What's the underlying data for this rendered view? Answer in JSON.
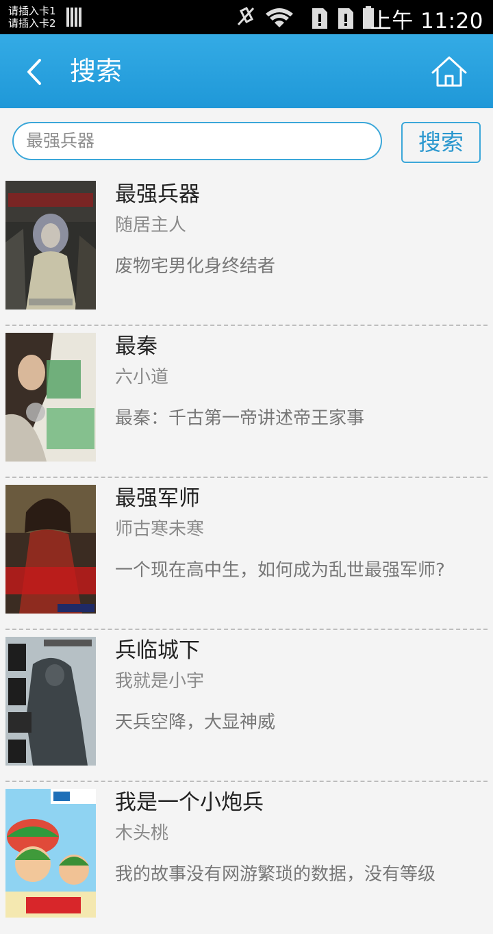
{
  "statusbar": {
    "sim1": "请插入卡1",
    "sim2": "请插入卡2",
    "time": "上午 11:20"
  },
  "header": {
    "title": "搜索",
    "back_icon": "chevron-left-icon",
    "home_icon": "home-icon"
  },
  "search": {
    "value": "最强兵器",
    "button_label": "搜索"
  },
  "results": [
    {
      "title": "最强兵器",
      "author": "随居主人",
      "desc": "废物宅男化身终结者"
    },
    {
      "title": "最秦",
      "author": "六小道",
      "desc": "最秦：千古第一帝讲述帝王家事"
    },
    {
      "title": "最强军师",
      "author": "师古寒未寒",
      "desc": "一个现在高中生，如何成为乱世最强军师?"
    },
    {
      "title": "兵临城下",
      "author": "我就是小宇",
      "desc": "天兵空降，大显神威"
    },
    {
      "title": "我是一个小炮兵",
      "author": "木头桃",
      "desc": "我的故事没有网游繁琐的数据，没有等级"
    }
  ],
  "colors": {
    "accent": "#1f98d8",
    "header_top": "#34abe5",
    "background": "#f4f4f4"
  }
}
